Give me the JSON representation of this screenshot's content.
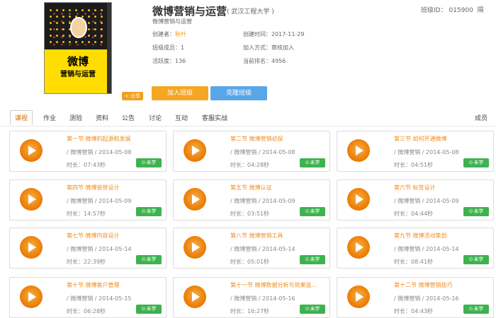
{
  "course": {
    "cover_title": "微博",
    "cover_subtitle": "营销与运营",
    "title": "微博营销与运营",
    "school": "( 武汉工程大学 )",
    "class_id_label": "班级ID：",
    "class_id_value": "015900",
    "class_id_extra": "隔",
    "description": "微博营销与运营",
    "creator_label": "创建者：",
    "creator_value": "秋叶",
    "created_label": "创建时间：",
    "created_value": "2017-11-29",
    "members_label": "班级成员：",
    "members_value": "1",
    "join_mode_label": "加入方式：",
    "join_mode_value": "审核加入",
    "activity_label": "活跃度：",
    "activity_value": "136",
    "rank_label": "当前排名：",
    "rank_value": "4956",
    "share_label": "分享",
    "join_button": "加入班级",
    "clone_button": "克隆班级"
  },
  "tabs": [
    "课程",
    "作业",
    "测验",
    "资料",
    "公告",
    "讨论",
    "互动",
    "客服实战"
  ],
  "members_tab": "成员",
  "lessons": [
    {
      "title": "第一节 微博的起源和发展",
      "sub": "/ 微博营销 / 2014-05-08",
      "duration": "时长：07:43秒",
      "status": "未学"
    },
    {
      "title": "第二节 微博营销初探",
      "sub": "/ 微博营销 / 2014-05-08",
      "duration": "时长：04:28秒",
      "status": "未学"
    },
    {
      "title": "第三节 如何开通微博",
      "sub": "/ 微博营销 / 2014-05-08",
      "duration": "时长：04:51秒",
      "status": "未学"
    },
    {
      "title": "第四节 微博装修设计",
      "sub": "/ 微博营销 / 2014-05-09",
      "duration": "时长：14:57秒",
      "status": "未学"
    },
    {
      "title": "第五节 微博认证",
      "sub": "/ 微博营销 / 2014-05-09",
      "duration": "时长：03:51秒",
      "status": "未学"
    },
    {
      "title": "第六节 标签设计",
      "sub": "/ 微博营销 / 2014-05-09",
      "duration": "时长：04:44秒",
      "status": "未学"
    },
    {
      "title": "第七节 微博内容设计",
      "sub": "/ 微博营销 / 2014-05-14",
      "duration": "时长：22:39秒",
      "status": "未学"
    },
    {
      "title": "第八节 微博营销工具",
      "sub": "/ 微博营销 / 2014-05-14",
      "duration": "时长：05:01秒",
      "status": "未学"
    },
    {
      "title": "第九节 微博活动策划",
      "sub": "/ 微博营销 / 2014-05-14",
      "duration": "时长：08:41秒",
      "status": "未学"
    },
    {
      "title": "第十节 微博客户管理",
      "sub": "/ 微博营销 / 2014-05-15",
      "duration": "时长：06:28秒",
      "status": "未学"
    },
    {
      "title": "第十一节 微博数据分析与效果监...",
      "sub": "/ 微博营销 / 2014-05-16",
      "duration": "时长：16:27秒",
      "status": "未学"
    },
    {
      "title": "第十二节 微博营销技巧",
      "sub": "/ 微博营销 / 2014-05-16",
      "duration": "时长：04:43秒",
      "status": "未学"
    }
  ]
}
